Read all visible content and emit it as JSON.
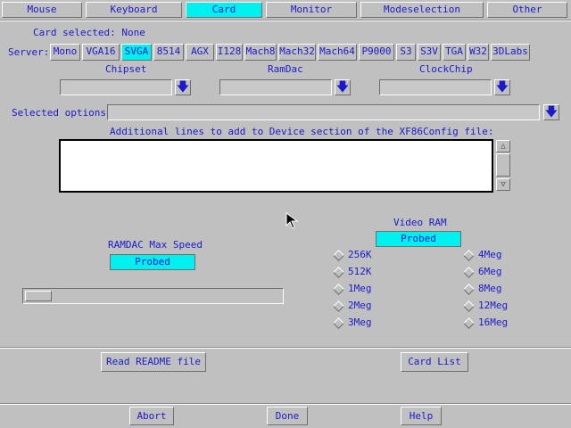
{
  "tabs": [
    {
      "label": "Mouse",
      "selected": false
    },
    {
      "label": "Keyboard",
      "selected": false
    },
    {
      "label": "Card",
      "selected": true
    },
    {
      "label": "Monitor",
      "selected": false
    },
    {
      "label": "Modeselection",
      "selected": false
    },
    {
      "label": "Other",
      "selected": false
    }
  ],
  "card_selected": "Card selected: None",
  "server": {
    "label": "Server:",
    "options": [
      "Mono",
      "VGA16",
      "SVGA",
      "8514",
      "AGX",
      "I128",
      "Mach8",
      "Mach32",
      "Mach64",
      "P9000",
      "S3",
      "S3V",
      "TGA",
      "W32",
      "3DLabs"
    ],
    "selected": "SVGA"
  },
  "chipset": {
    "label": "Chipset",
    "value": ""
  },
  "ramdac": {
    "label": "RamDac",
    "value": ""
  },
  "clockchip": {
    "label": "ClockChip",
    "value": ""
  },
  "selected_options": {
    "label": "Selected options:",
    "value": ""
  },
  "additional_lines": {
    "label": "Additional lines to add to Device section of the XF86Config file:",
    "value": ""
  },
  "video_ram": {
    "label": "Video RAM",
    "value": "Probed",
    "left_options": [
      "256K",
      "512K",
      "1Meg",
      "2Meg",
      "3Meg"
    ],
    "right_options": [
      "4Meg",
      "6Meg",
      "8Meg",
      "12Meg",
      "16Meg"
    ]
  },
  "ramdac_speed": {
    "label": "RAMDAC Max Speed",
    "value": "Probed"
  },
  "buttons": {
    "readme": "Read README file",
    "card_list": "Card List",
    "abort": "Abort",
    "done": "Done",
    "help": "Help"
  },
  "colors": {
    "accent": "#00f0f0",
    "text": "#1a1acc",
    "background": "#c0c0c0"
  },
  "icons": {
    "arrow": "down-arrow-icon"
  }
}
